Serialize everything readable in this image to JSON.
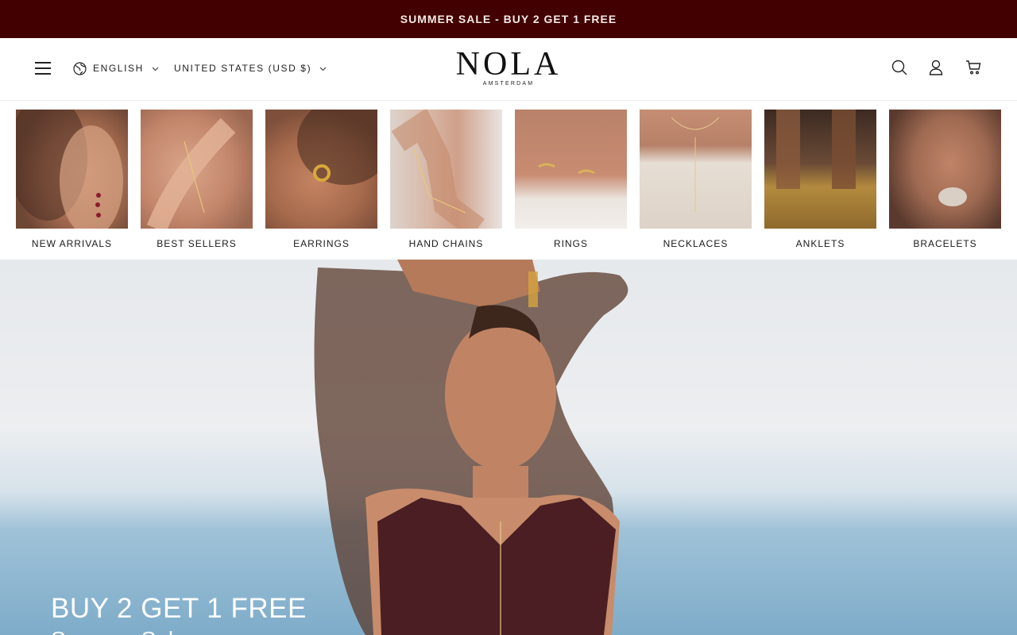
{
  "announcement": {
    "text": "SUMMER SALE - BUY 2 GET 1 FREE"
  },
  "header": {
    "language": "ENGLISH",
    "currency": "UNITED STATES (USD $)",
    "logo": {
      "main": "NOLA",
      "sub": "AMSTERDAM"
    }
  },
  "categories": [
    {
      "label": "NEW ARRIVALS"
    },
    {
      "label": "BEST SELLERS"
    },
    {
      "label": "EARRINGS"
    },
    {
      "label": "HAND CHAINS"
    },
    {
      "label": "RINGS"
    },
    {
      "label": "NECKLACES"
    },
    {
      "label": "ANKLETS"
    },
    {
      "label": "BRACELETS"
    }
  ],
  "hero": {
    "title": "BUY 2 GET 1 FREE",
    "subtitle": "Summer Sale"
  },
  "colors": {
    "announcement_bg": "#420000",
    "announcement_text": "#f3e9e6"
  },
  "icons": [
    "menu-icon",
    "globe-icon",
    "chevron-down-icon",
    "search-icon",
    "account-icon",
    "cart-icon"
  ]
}
